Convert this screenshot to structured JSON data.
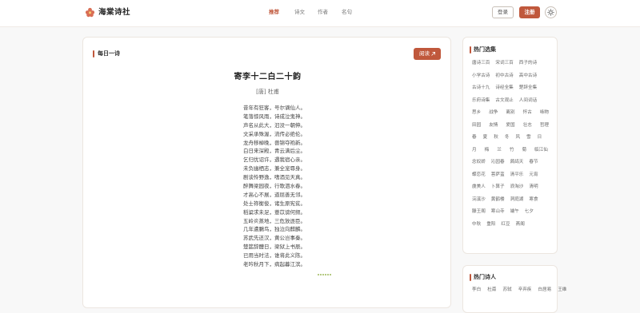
{
  "header": {
    "site_name": "海棠诗社",
    "nav": [
      {
        "label": "推荐",
        "active": true
      },
      {
        "label": "诗文",
        "active": false
      },
      {
        "label": "作者",
        "active": false
      },
      {
        "label": "名句",
        "active": false
      }
    ],
    "login_label": "登录",
    "register_label": "注册",
    "theme_icon": "sun-icon"
  },
  "daily": {
    "section_title": "每日一诗",
    "read_label": "阅读",
    "read_icon": "external-link-icon",
    "poem_title": "寄李十二白二十韵",
    "poem_author": "[唐] 杜甫",
    "lines": [
      "昔年有狂客，号尔谪仙人。",
      "笔落惊风雨，诗成泣鬼神。",
      "声名从此大，汩没一朝伸。",
      "文采承殊渥，流传必绝伦。",
      "龙舟移棹晚，兽锦夺袍新。",
      "白日来深殿，青云满后尘。",
      "乞归优诏许，遇我宿心亲。",
      "未负幽栖志，兼全宠辱身。",
      "剧谈怜野逸，嗜酒见天真。",
      "醉舞梁园夜，行歌泗水春。",
      "才高心不展，道屈善无邻。",
      "处士祢衡俊，诸生原宪贫。",
      "稻粱求未足，薏苡谤何频。",
      "五岭炎蒸地，三危放逐臣。",
      "几年遭鵩鸟，独泣向麒麟。",
      "苏武先还汉，黄公岂事秦。",
      "楚筵辞醴日，梁狱上书辰。",
      "已用当时法，谁将此义陈。",
      "老吟秋月下，病起暮江滨。"
    ]
  },
  "hot_collections": {
    "section_title": "热门选集",
    "tags": [
      [
        "唐诗三百",
        "宋词三百",
        "西子的诗"
      ],
      [
        "小学古诗",
        "初中古诗",
        "高中古诗"
      ],
      [
        "古诗十九",
        "诗经全集",
        "楚辞全集"
      ],
      [
        "乐府诗集",
        "古文观止",
        "人间词话"
      ],
      [
        "思乡",
        "战争",
        "离别",
        "怀古",
        "咏物"
      ],
      [
        "田园",
        "友情",
        "爱国",
        "壮志",
        "哲理"
      ],
      [
        "春",
        "夏",
        "秋",
        "冬",
        "风",
        "雪",
        "日"
      ],
      [
        "月",
        "梅",
        "兰",
        "竹",
        "菊",
        "临江仙"
      ],
      [
        "念奴娇",
        "沁园春",
        "鹧鸪天",
        "春节"
      ],
      [
        "蝶恋花",
        "菩萨蛮",
        "清平乐",
        "元宵"
      ],
      [
        "虞美人",
        "卜算子",
        "浪淘沙",
        "清明"
      ],
      [
        "浣溪沙",
        "黄鹤楼",
        "洞庭湖",
        "寒食"
      ],
      [
        "滕王阁",
        "寒山寺",
        "端午",
        "七夕"
      ],
      [
        "中秋",
        "重阳",
        "红豆",
        "燕阁"
      ]
    ]
  },
  "hot_poets": {
    "section_title": "热门诗人",
    "poets": [
      "李白",
      "杜甫",
      "苏轼",
      "辛弃疾",
      "白居易",
      "王维"
    ]
  },
  "colors": {
    "accent": "#c0583c",
    "loading_dots": "#9db85a"
  }
}
